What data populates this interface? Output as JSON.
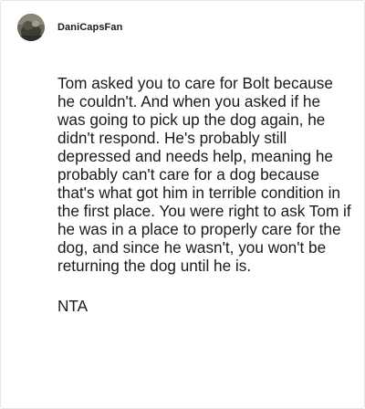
{
  "comment": {
    "username": "DaniCapsFan",
    "avatar_icon": "user-avatar-photo",
    "paragraphs": [
      "Tom asked you to care for Bolt because he couldn't. And when you asked if he was going to pick up the dog again, he didn't respond. He's probably still depressed and needs help, meaning he probably can't care for a dog because that's what got him in terrible condition in the first place. You were right to ask Tom if he was in a place to properly care for the dog, and since he wasn't, you won't be returning the dog until he is.",
      "NTA"
    ]
  }
}
